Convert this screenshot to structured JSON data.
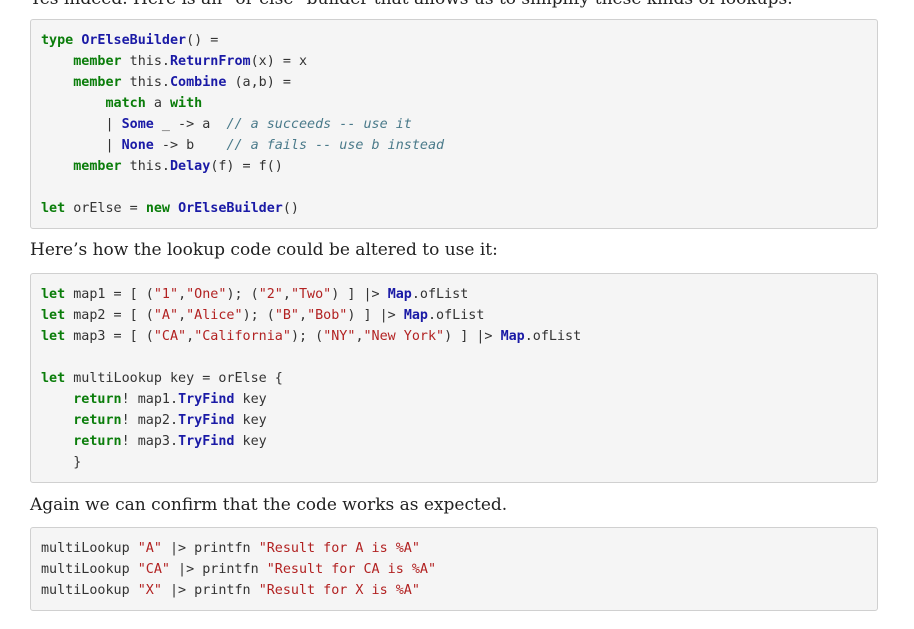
{
  "intro_cut": "Yes indeed. Here is an \"or else\" builder that allows us to simplify these kinds of lookups.",
  "paragraph_1": "Here’s how the lookup code could be altered to use it:",
  "paragraph_2": "Again we can confirm that the code works as expected.",
  "code_block_1": {
    "lines": [
      [
        {
          "t": "type",
          "c": "kw"
        },
        {
          "t": " ",
          "c": "op"
        },
        {
          "t": "OrElseBuilder",
          "c": "ty"
        },
        {
          "t": "() =",
          "c": "op"
        }
      ],
      [
        {
          "t": "    ",
          "c": "op"
        },
        {
          "t": "member",
          "c": "kw"
        },
        {
          "t": " this.",
          "c": "op"
        },
        {
          "t": "ReturnFrom",
          "c": "ty"
        },
        {
          "t": "(x) = x",
          "c": "op"
        }
      ],
      [
        {
          "t": "    ",
          "c": "op"
        },
        {
          "t": "member",
          "c": "kw"
        },
        {
          "t": " this.",
          "c": "op"
        },
        {
          "t": "Combine",
          "c": "ty"
        },
        {
          "t": " (a,b) =",
          "c": "op"
        }
      ],
      [
        {
          "t": "        ",
          "c": "op"
        },
        {
          "t": "match",
          "c": "kw"
        },
        {
          "t": " a ",
          "c": "op"
        },
        {
          "t": "with",
          "c": "kw"
        }
      ],
      [
        {
          "t": "        | ",
          "c": "op"
        },
        {
          "t": "Some",
          "c": "ty"
        },
        {
          "t": " _ -> a  ",
          "c": "op"
        },
        {
          "t": "// a succeeds -- use it",
          "c": "cm"
        }
      ],
      [
        {
          "t": "        | ",
          "c": "op"
        },
        {
          "t": "None",
          "c": "ty"
        },
        {
          "t": " -> b    ",
          "c": "op"
        },
        {
          "t": "// a fails -- use b instead",
          "c": "cm"
        }
      ],
      [
        {
          "t": "    ",
          "c": "op"
        },
        {
          "t": "member",
          "c": "kw"
        },
        {
          "t": " this.",
          "c": "op"
        },
        {
          "t": "Delay",
          "c": "ty"
        },
        {
          "t": "(f) = f()",
          "c": "op"
        }
      ],
      [],
      [
        {
          "t": "let",
          "c": "kw"
        },
        {
          "t": " orElse = ",
          "c": "op"
        },
        {
          "t": "new",
          "c": "kw"
        },
        {
          "t": " ",
          "c": "op"
        },
        {
          "t": "OrElseBuilder",
          "c": "ty"
        },
        {
          "t": "()",
          "c": "op"
        }
      ]
    ]
  },
  "code_block_2": {
    "lines": [
      [
        {
          "t": "let",
          "c": "kw"
        },
        {
          "t": " map1 = [ (",
          "c": "op"
        },
        {
          "t": "\"1\"",
          "c": "str"
        },
        {
          "t": ",",
          "c": "op"
        },
        {
          "t": "\"One\"",
          "c": "str"
        },
        {
          "t": "); (",
          "c": "op"
        },
        {
          "t": "\"2\"",
          "c": "str"
        },
        {
          "t": ",",
          "c": "op"
        },
        {
          "t": "\"Two\"",
          "c": "str"
        },
        {
          "t": ") ] |> ",
          "c": "op"
        },
        {
          "t": "Map",
          "c": "ty"
        },
        {
          "t": ".ofList",
          "c": "op"
        }
      ],
      [
        {
          "t": "let",
          "c": "kw"
        },
        {
          "t": " map2 = [ (",
          "c": "op"
        },
        {
          "t": "\"A\"",
          "c": "str"
        },
        {
          "t": ",",
          "c": "op"
        },
        {
          "t": "\"Alice\"",
          "c": "str"
        },
        {
          "t": "); (",
          "c": "op"
        },
        {
          "t": "\"B\"",
          "c": "str"
        },
        {
          "t": ",",
          "c": "op"
        },
        {
          "t": "\"Bob\"",
          "c": "str"
        },
        {
          "t": ") ] |> ",
          "c": "op"
        },
        {
          "t": "Map",
          "c": "ty"
        },
        {
          "t": ".ofList",
          "c": "op"
        }
      ],
      [
        {
          "t": "let",
          "c": "kw"
        },
        {
          "t": " map3 = [ (",
          "c": "op"
        },
        {
          "t": "\"CA\"",
          "c": "str"
        },
        {
          "t": ",",
          "c": "op"
        },
        {
          "t": "\"California\"",
          "c": "str"
        },
        {
          "t": "); (",
          "c": "op"
        },
        {
          "t": "\"NY\"",
          "c": "str"
        },
        {
          "t": ",",
          "c": "op"
        },
        {
          "t": "\"New York\"",
          "c": "str"
        },
        {
          "t": ") ] |> ",
          "c": "op"
        },
        {
          "t": "Map",
          "c": "ty"
        },
        {
          "t": ".ofList",
          "c": "op"
        }
      ],
      [],
      [
        {
          "t": "let",
          "c": "kw"
        },
        {
          "t": " multiLookup key = orElse {",
          "c": "op"
        }
      ],
      [
        {
          "t": "    ",
          "c": "op"
        },
        {
          "t": "return",
          "c": "kw"
        },
        {
          "t": "! map1.",
          "c": "op"
        },
        {
          "t": "TryFind",
          "c": "ty"
        },
        {
          "t": " key",
          "c": "op"
        }
      ],
      [
        {
          "t": "    ",
          "c": "op"
        },
        {
          "t": "return",
          "c": "kw"
        },
        {
          "t": "! map2.",
          "c": "op"
        },
        {
          "t": "TryFind",
          "c": "ty"
        },
        {
          "t": " key",
          "c": "op"
        }
      ],
      [
        {
          "t": "    ",
          "c": "op"
        },
        {
          "t": "return",
          "c": "kw"
        },
        {
          "t": "! map3.",
          "c": "op"
        },
        {
          "t": "TryFind",
          "c": "ty"
        },
        {
          "t": " key",
          "c": "op"
        }
      ],
      [
        {
          "t": "    }",
          "c": "op"
        }
      ]
    ]
  },
  "code_block_3": {
    "lines": [
      [
        {
          "t": "multiLookup ",
          "c": "op"
        },
        {
          "t": "\"A\"",
          "c": "str"
        },
        {
          "t": " |> printfn ",
          "c": "op"
        },
        {
          "t": "\"Result for A is %A\"",
          "c": "str"
        }
      ],
      [
        {
          "t": "multiLookup ",
          "c": "op"
        },
        {
          "t": "\"CA\"",
          "c": "str"
        },
        {
          "t": " |> printfn ",
          "c": "op"
        },
        {
          "t": "\"Result for CA is %A\"",
          "c": "str"
        }
      ],
      [
        {
          "t": "multiLookup ",
          "c": "op"
        },
        {
          "t": "\"X\"",
          "c": "str"
        },
        {
          "t": " |> printfn ",
          "c": "op"
        },
        {
          "t": "\"Result for X is %A\"",
          "c": "str"
        }
      ]
    ]
  }
}
